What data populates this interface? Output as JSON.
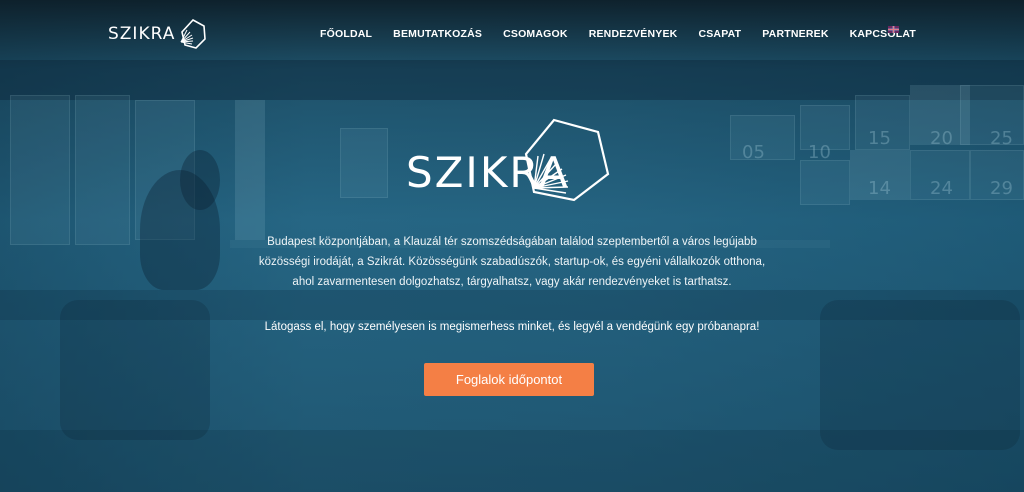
{
  "brand": {
    "name": "SZIKRA"
  },
  "nav": {
    "items": [
      "FŐOLDAL",
      "BEMUTATKOZÁS",
      "CSOMAGOK",
      "RENDEZVÉNYEK",
      "CSAPAT",
      "PARTNEREK",
      "KAPCSOLAT"
    ],
    "language_flag": "uk-flag-icon"
  },
  "hero": {
    "logo_text": "SZIKRA",
    "intro_lines": [
      "Budapest központjában, a Klauzál tér szomszédságában találod szeptembertől a város legújabb",
      "közösségi irodáját, a Szikrát. Közösségünk szabadúszók, startup-ok, és egyéni vállalkozók otthona,",
      "ahol zavarmentesen dolgozhatsz, tárgyalhatsz, vagy akár rendezvényeket is tarthatsz."
    ],
    "invite": "Látogass el, hogy személyesen is megismerhess minket, és legyél a vendégünk egy próbanapra!",
    "cta_label": "Foglalok időpontot"
  },
  "colors": {
    "accent": "#f47f45",
    "overlay": "#1f5672"
  }
}
